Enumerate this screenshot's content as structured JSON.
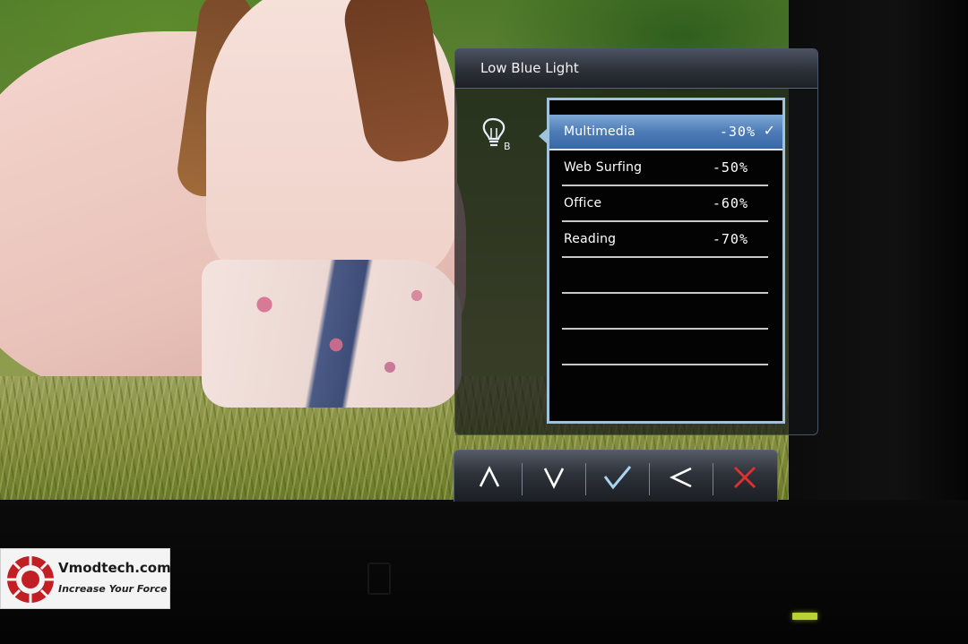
{
  "osd": {
    "title": "Low Blue Light",
    "mode_icon": "bulb-b-icon",
    "items": [
      {
        "label": "Multimedia",
        "value": "-30%",
        "selected": true
      },
      {
        "label": "Web Surfing",
        "value": "-50%",
        "selected": false
      },
      {
        "label": "Office",
        "value": "-60%",
        "selected": false
      },
      {
        "label": "Reading",
        "value": "-70%",
        "selected": false
      },
      {
        "label": "",
        "value": "",
        "selected": false
      },
      {
        "label": "",
        "value": "",
        "selected": false
      },
      {
        "label": "",
        "value": "",
        "selected": false
      }
    ],
    "selected_mark": "✓",
    "colors": {
      "highlight": "#4d7cb7",
      "frame": "#9fc3de",
      "exit": "#e03030"
    }
  },
  "keys": [
    {
      "name": "up-key",
      "icon": "chevron-up-icon"
    },
    {
      "name": "down-key",
      "icon": "chevron-down-icon"
    },
    {
      "name": "confirm-key",
      "icon": "check-icon"
    },
    {
      "name": "back-key",
      "icon": "chevron-left-icon"
    },
    {
      "name": "exit-key",
      "icon": "close-icon"
    }
  ],
  "watermark": {
    "site": "Vmodtech.com",
    "tagline": "Increase Your Force"
  }
}
